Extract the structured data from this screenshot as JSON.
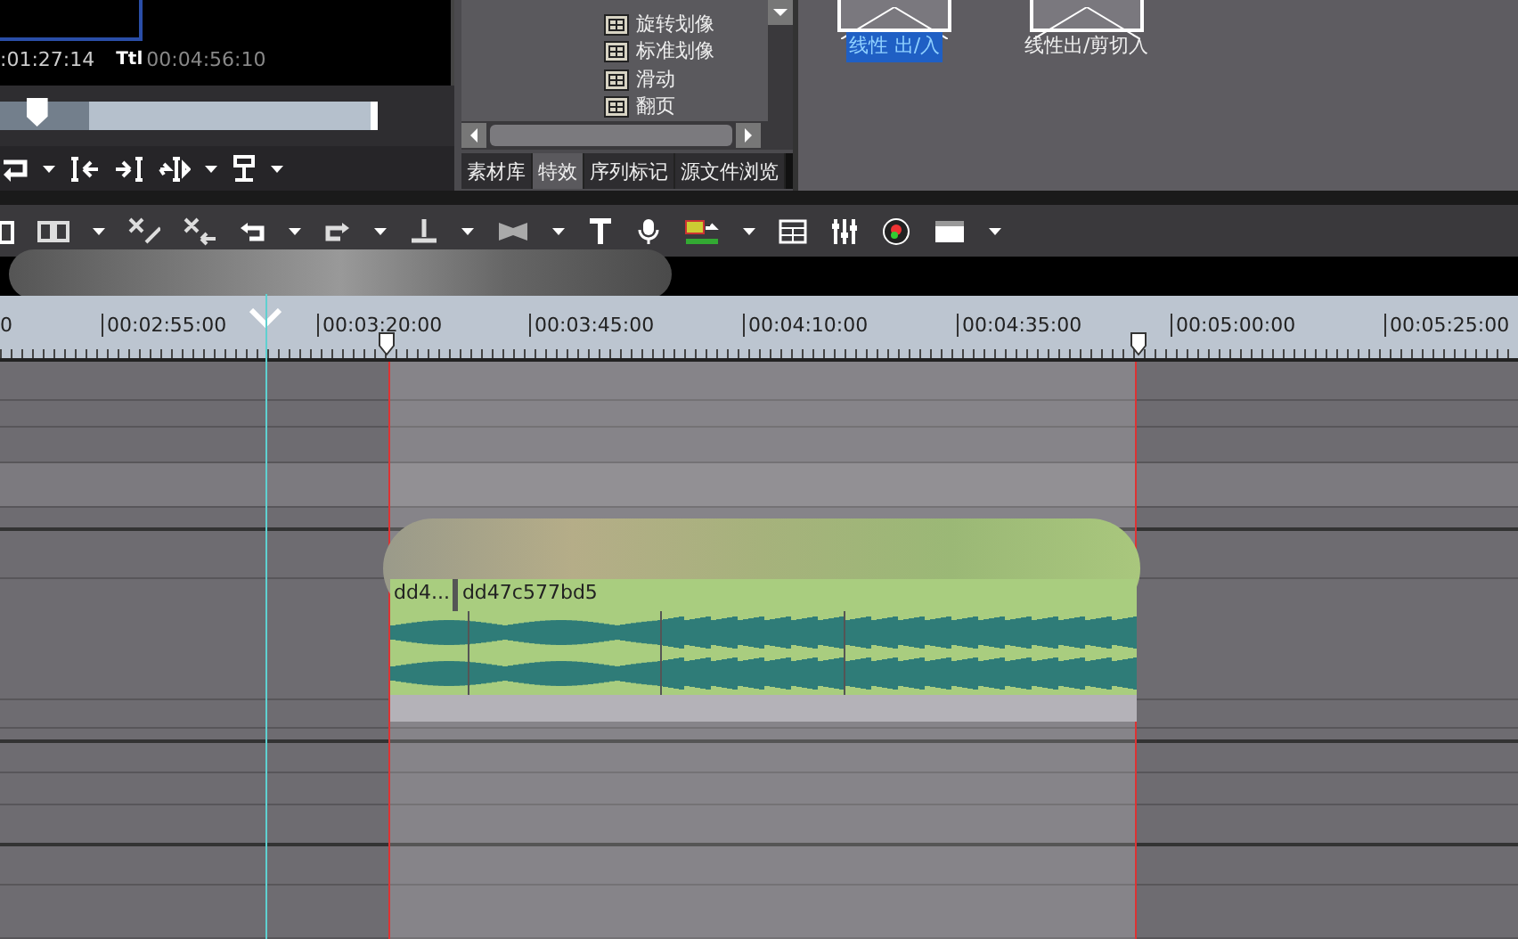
{
  "preview": {
    "timecode": ":01:27:14",
    "total_label": "Ttl",
    "total_timecode": "00:04:56:10",
    "scrubber": {
      "level": 0.1
    }
  },
  "effects_tree": {
    "items": [
      {
        "label": "旋转划像"
      },
      {
        "label": "标准划像"
      },
      {
        "label": "滑动"
      },
      {
        "label": "翻页"
      }
    ]
  },
  "panel_tabs": [
    {
      "label": "素材库",
      "selected": false
    },
    {
      "label": "特效",
      "selected": true
    },
    {
      "label": "序列标记",
      "selected": false
    },
    {
      "label": "源文件浏览",
      "selected": false
    }
  ],
  "transitions": [
    {
      "label": "线性 出/入",
      "selected": true
    },
    {
      "label": "线性出/剪切入",
      "selected": false
    }
  ],
  "ruler": {
    "labels": [
      "0",
      "00:02:55:00",
      "00:03:20:00",
      "00:03:45:00",
      "00:04:10:00",
      "00:04:35:00",
      "00:05:00:00",
      "00:05:25:00"
    ]
  },
  "clips": [
    {
      "label": "dd4..."
    },
    {
      "label": "dd47c577bd5"
    }
  ]
}
